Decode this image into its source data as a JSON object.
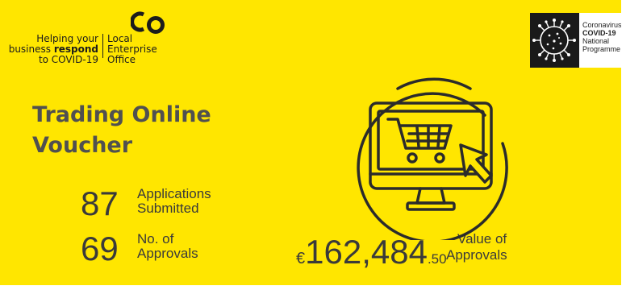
{
  "header": {
    "tagline_line1": "Helping your",
    "tagline_line2_prefix": "business ",
    "tagline_line2_bold": "respond",
    "tagline_line3": "to COVID-19",
    "org_line1": "Local",
    "org_line2": "Enterprise",
    "org_line3": "Office",
    "logo_icon": "leo-co-mark"
  },
  "badge": {
    "line1": "Coronavirus",
    "line2": "COVID-19",
    "line3": "National",
    "line4": "Programme",
    "icon": "virus-icon"
  },
  "title": {
    "line1": "Trading Online",
    "line2": "Voucher"
  },
  "stats": {
    "applications": {
      "number": "87",
      "label_line1": "Applications",
      "label_line2": "Submitted"
    },
    "approvals": {
      "number": "69",
      "label_line1": "No. of",
      "label_line2": "Approvals"
    },
    "value": {
      "currency": "€",
      "number": "162,484",
      "cents": ".50",
      "label_line1": "Value of",
      "label_line2": "Approvals"
    }
  },
  "illustration": {
    "icon": "online-shopping-monitor-icon"
  },
  "colors": {
    "background": "#ffe600",
    "text": "#3a3a3a",
    "title": "#505050",
    "line": "#2b2b2b"
  }
}
